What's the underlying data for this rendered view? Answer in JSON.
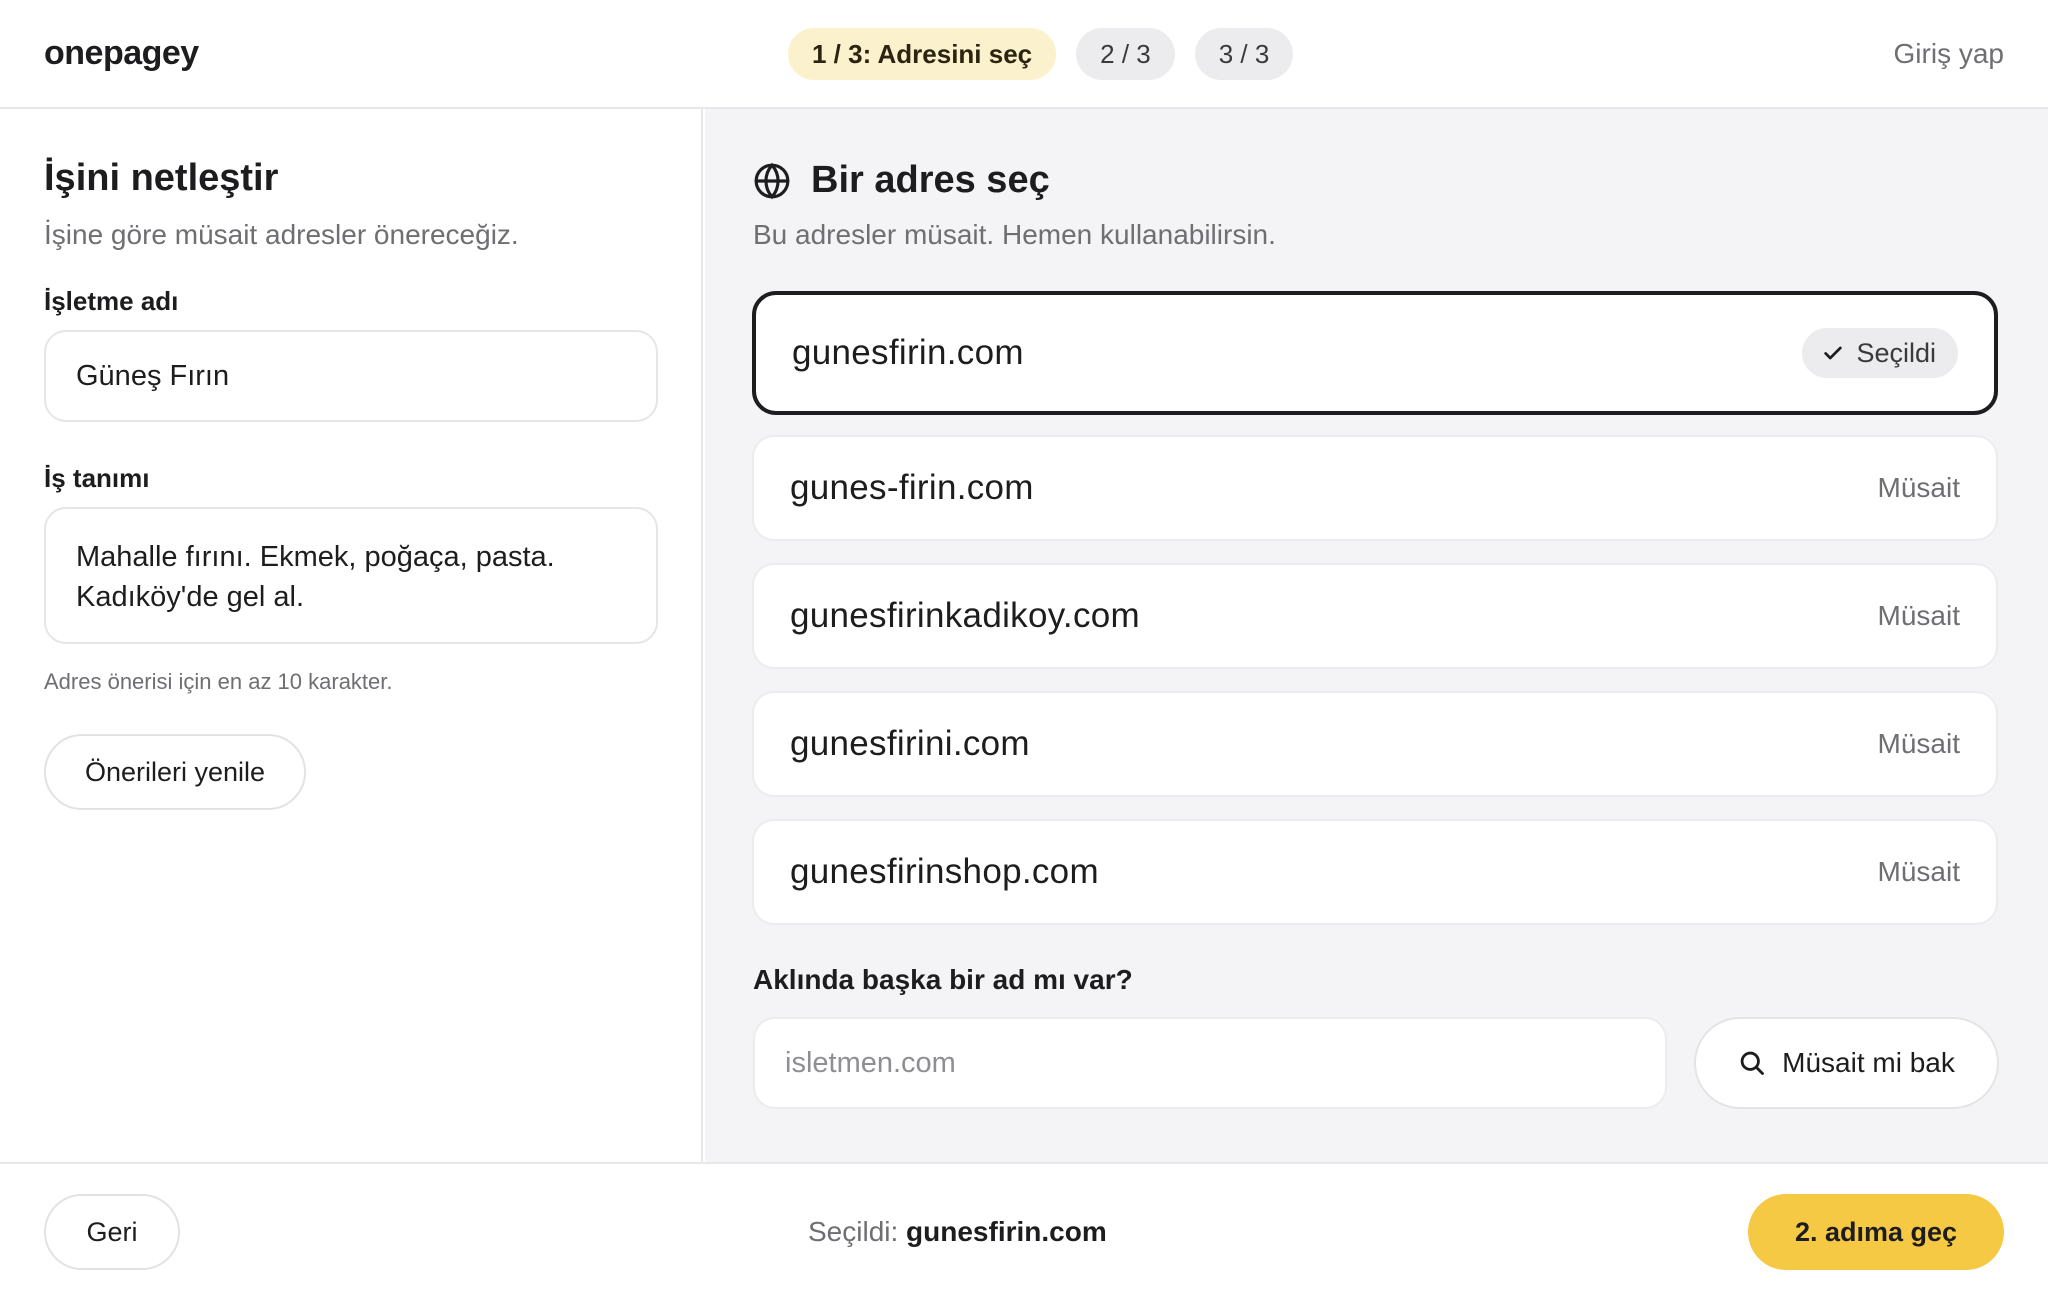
{
  "header": {
    "logo": "onepagey",
    "steps": [
      {
        "label": "1 / 3: Adresini seç",
        "active": true
      },
      {
        "label": "2 / 3",
        "active": false
      },
      {
        "label": "3 / 3",
        "active": false
      }
    ],
    "login_label": "Giriş yap"
  },
  "left": {
    "title": "İşini netleştir",
    "subtitle": "İşine göre müsait adresler önereceğiz.",
    "business_name_label": "İşletme adı",
    "business_name_value": "Güneş Fırın",
    "description_label": "İş tanımı",
    "description_value": "Mahalle fırını. Ekmek, poğaça, pasta. Kadıköy'de gel al.",
    "hint": "Adres önerisi için en az 10 karakter.",
    "refresh_button": "Önerileri yenile"
  },
  "right": {
    "icon": "globe-icon",
    "title": "Bir adres seç",
    "subtitle": "Bu adresler müsait. Hemen kullanabilirsin.",
    "domains": [
      {
        "name": "gunesfirin.com",
        "status": "Seçildi",
        "selected": true
      },
      {
        "name": "gunes-firin.com",
        "status": "Müsait",
        "selected": false
      },
      {
        "name": "gunesfirinkadikoy.com",
        "status": "Müsait",
        "selected": false
      },
      {
        "name": "gunesfirini.com",
        "status": "Müsait",
        "selected": false
      },
      {
        "name": "gunesfirinshop.com",
        "status": "Müsait",
        "selected": false
      }
    ],
    "other_label": "Aklında başka bir ad mı var?",
    "other_placeholder": "isletmen.com",
    "other_value": "",
    "check_button": "Müsait mi bak"
  },
  "footer": {
    "back_button": "Geri",
    "selection_prefix": "Seçildi:",
    "selection_value": "gunesfirin.com",
    "next_button": "2. adıma geç"
  },
  "colors": {
    "accent": "#f6c944",
    "active_step_bg": "#fbf1cc",
    "panel_bg": "#f4f4f6",
    "selected_border": "#1d1d1f"
  }
}
